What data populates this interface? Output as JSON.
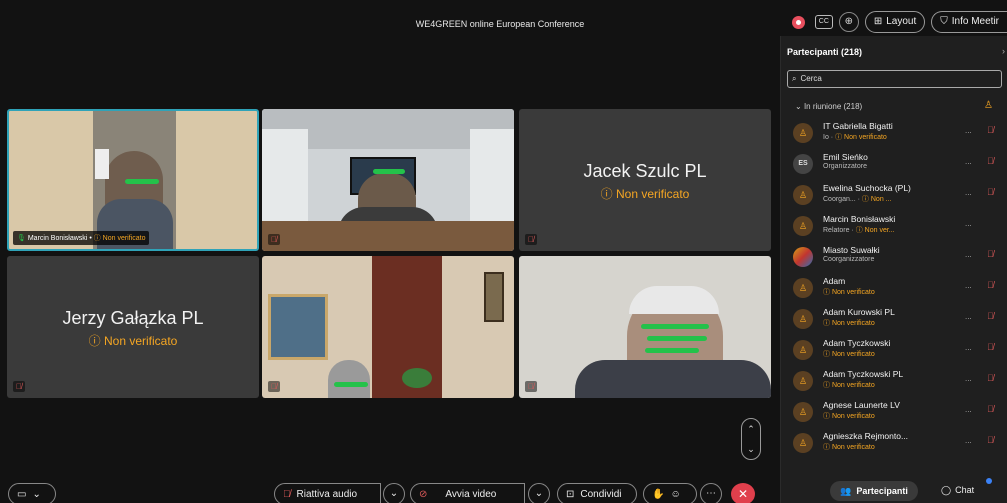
{
  "meeting": {
    "title": "WE4GREEN online European Conference"
  },
  "top_controls": {
    "cc_label": "CC",
    "layout_label": "Layout",
    "info_label": "Info Meetir"
  },
  "tiles": [
    {
      "name": "Marcin Bonisławski",
      "status": "Non verificato"
    },
    {
      "big_name": "Jacek Szulc PL",
      "status": "Non verificato"
    },
    {
      "big_name": "Jerzy Gałązka PL",
      "status": "Non verificato"
    }
  ],
  "bottom_bar": {
    "audio_label": "Riattiva audio",
    "video_label": "Avvia video",
    "share_label": "Condividi"
  },
  "panel": {
    "title": "Partecipanti (218)",
    "search_placeholder": "Cerca",
    "group_label": "In riunione (218)",
    "participants": [
      {
        "initials": "",
        "name": "IT Gabriella Bigatti",
        "sub_role": "Io",
        "sub_status": "Non verificato",
        "more": "...",
        "muted": true
      },
      {
        "initials": "ES",
        "name": "Emil Sieńko",
        "sub_role": "Organizzatore",
        "sub_status": "",
        "more": "...",
        "muted": true
      },
      {
        "initials": "",
        "name": "Ewelina Suchocka (PL)",
        "sub_role": "Coorgan...",
        "sub_status": "Non ...",
        "more": "...",
        "muted": true
      },
      {
        "initials": "",
        "name": "Marcin Bonisławski",
        "sub_role": "Relatore",
        "sub_status": "Non ver...",
        "more": "...",
        "muted": false
      },
      {
        "initials": "",
        "name": "Miasto Suwałki",
        "sub_role": "Coorganizzatore",
        "sub_status": "",
        "more": "...",
        "muted": true
      },
      {
        "initials": "",
        "name": "Adam",
        "sub_role": "",
        "sub_status": "Non verificato",
        "more": "...",
        "muted": true
      },
      {
        "initials": "",
        "name": "Adam Kurowski PL",
        "sub_role": "",
        "sub_status": "Non verificato",
        "more": "...",
        "muted": true
      },
      {
        "initials": "",
        "name": "Adam Tyczkowski",
        "sub_role": "",
        "sub_status": "Non verificato",
        "more": "...",
        "muted": true
      },
      {
        "initials": "",
        "name": "Adam Tyczkowski PL",
        "sub_role": "",
        "sub_status": "Non verificato",
        "more": "...",
        "muted": true
      },
      {
        "initials": "",
        "name": "Agnese Launerte LV",
        "sub_role": "",
        "sub_status": "Non verificato",
        "more": "...",
        "muted": true
      },
      {
        "initials": "",
        "name": "Agnieszka Rejmonto...",
        "sub_role": "",
        "sub_status": "Non verificato",
        "more": "...",
        "muted": true
      }
    ],
    "footer": {
      "participants_label": "Partecipanti",
      "chat_label": "Chat"
    }
  },
  "colors": {
    "accent_orange": "#f5a623",
    "active_border": "#2fa3b8",
    "leave_red": "#e03f4c",
    "censor_green": "#24c24a"
  }
}
